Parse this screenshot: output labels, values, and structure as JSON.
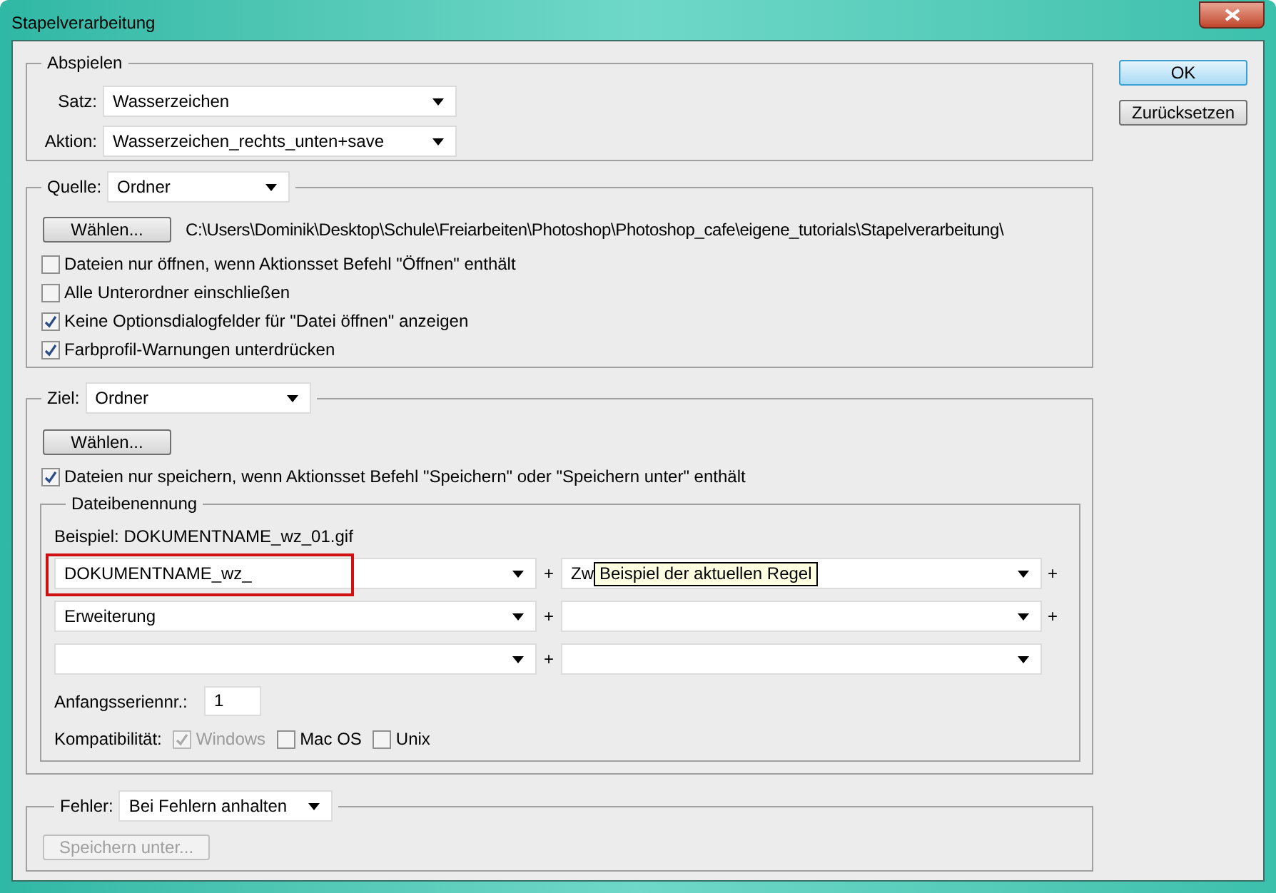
{
  "window": {
    "title": "Stapelverarbeitung"
  },
  "buttons": [
    {
      "label": "OK",
      "default": true
    },
    {
      "label": "Zurücksetzen",
      "default": false
    }
  ],
  "play": {
    "title": "Abspielen",
    "fields": [
      {
        "label": "Satz:",
        "value": "Wasserzeichen"
      },
      {
        "label": "Aktion:",
        "value": "Wasserzeichen_rechts_unten+save"
      }
    ]
  },
  "source": {
    "label": "Quelle:",
    "value": "Ordner",
    "choose_button": "Wählen...",
    "path": "C:\\Users\\Dominik\\Desktop\\Schule\\Freiarbeiten\\Photoshop\\Photoshop_cafe\\eigene_tutorials\\Stapelverarbeitung\\",
    "options": [
      {
        "label": "Dateien nur öffnen, wenn Aktionsset Befehl \"Öffnen\" enthält",
        "checked": false
      },
      {
        "label": "Alle Unterordner einschließen",
        "checked": false
      },
      {
        "label": "Keine Optionsdialogfelder für \"Datei öffnen\" anzeigen",
        "checked": true
      },
      {
        "label": "Farbprofil-Warnungen unterdrücken",
        "checked": true
      }
    ]
  },
  "destination": {
    "label": "Ziel:",
    "value": "Ordner",
    "choose_button": "Wählen...",
    "options": [
      {
        "label": "Dateien nur speichern, wenn Aktionsset Befehl \"Speichern\" oder \"Speichern unter\" enthält",
        "checked": true
      }
    ],
    "naming": {
      "title": "Dateibenennung",
      "example": "Beispiel: DOKUMENTNAME_wz_01.gif",
      "rows": [
        {
          "left": {
            "value": "DOKUMENTNAME_wz_",
            "highlighted": true
          },
          "plus": "+",
          "right": {
            "value": "Zw",
            "tooltip": "Beispiel der aktuellen Regel"
          },
          "trailing": "+"
        },
        {
          "left": {
            "value": "Erweiterung",
            "highlighted": false
          },
          "plus": "+",
          "right": {},
          "trailing": "+"
        },
        {
          "left": {
            "highlighted": false
          },
          "plus": "+",
          "right": {}
        }
      ],
      "serial": {
        "label": "Anfangsseriennr.:",
        "value": "1"
      },
      "compat": {
        "label": "Kompatibilität:",
        "options": [
          {
            "label": "Windows",
            "checked": true,
            "disabled": true
          },
          {
            "label": "Mac OS",
            "checked": false,
            "disabled": false
          },
          {
            "label": "Unix",
            "checked": false,
            "disabled": false
          }
        ]
      }
    }
  },
  "errors": {
    "label": "Fehler:",
    "value": "Bei Fehlern anhalten",
    "save_button": {
      "label": "Speichern unter...",
      "disabled": true
    }
  }
}
